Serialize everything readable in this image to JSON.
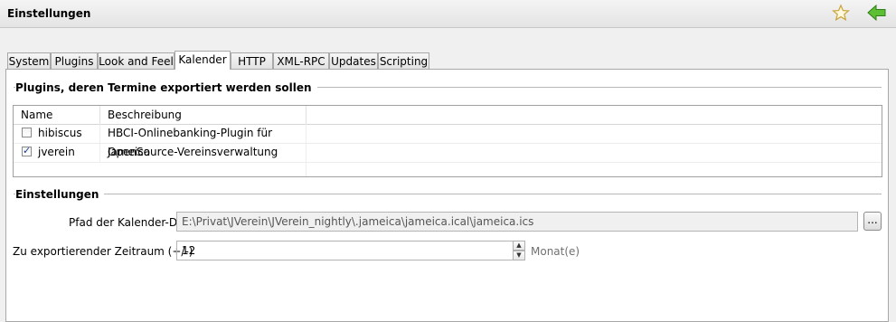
{
  "window": {
    "title": "Einstellungen"
  },
  "tabs": [
    {
      "label": "System"
    },
    {
      "label": "Plugins"
    },
    {
      "label": "Look and Feel"
    },
    {
      "label": "Kalender",
      "active": true
    },
    {
      "label": "HTTP"
    },
    {
      "label": "XML-RPC"
    },
    {
      "label": "Updates"
    },
    {
      "label": "Scripting"
    }
  ],
  "plugins_group": {
    "title": "Plugins, deren Termine exportiert werden sollen",
    "columns": [
      "Name",
      "Beschreibung"
    ],
    "rows": [
      {
        "name": "hibiscus",
        "description": "HBCI-Onlinebanking-Plugin für Jameica",
        "checked": false
      },
      {
        "name": "jverein",
        "description": "OpenSource-Vereinsverwaltung",
        "checked": true
      }
    ]
  },
  "settings_group": {
    "title": "Einstellungen",
    "path_label": "Pfad der Kalender-Datei",
    "path_value": "E:\\Privat\\JVerein\\JVerein_nightly\\.jameica\\jameica.ical\\jameica.ics",
    "browse_label": "...",
    "range_label": "Zu exportierender Zeitraum (+/-)",
    "range_value": "12",
    "range_unit": "Monat(e)"
  },
  "icons": {
    "favorite": "star-icon",
    "back": "back-arrow-icon"
  },
  "colors": {
    "back_arrow": "#4caf2a",
    "star_outline": "#c9a23a"
  }
}
